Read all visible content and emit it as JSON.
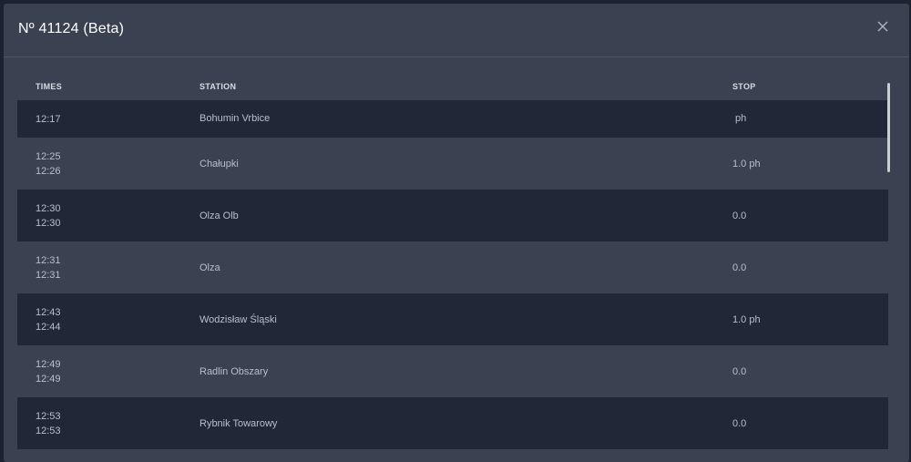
{
  "modal": {
    "title": "Nº 41124 (Beta)"
  },
  "table": {
    "headers": {
      "times": "TIMES",
      "station": "STATION",
      "stop": "STOP"
    },
    "rows": [
      {
        "arrival": "12:17",
        "departure": "",
        "station": "Bohumin Vrbice",
        "stop": " ph"
      },
      {
        "arrival": "12:25",
        "departure": "12:26",
        "station": "Chałupki",
        "stop": "1.0 ph"
      },
      {
        "arrival": "12:30",
        "departure": "12:30",
        "station": "Olza Olb",
        "stop": "0.0"
      },
      {
        "arrival": "12:31",
        "departure": "12:31",
        "station": "Olza",
        "stop": "0.0"
      },
      {
        "arrival": "12:43",
        "departure": "12:44",
        "station": "Wodzisław Śląski",
        "stop": "1.0 ph"
      },
      {
        "arrival": "12:49",
        "departure": "12:49",
        "station": "Radlin Obszary",
        "stop": "0.0"
      },
      {
        "arrival": "12:53",
        "departure": "12:53",
        "station": "Rybnik Towarowy",
        "stop": "0.0"
      }
    ]
  },
  "icons": {
    "close": "close-icon"
  }
}
